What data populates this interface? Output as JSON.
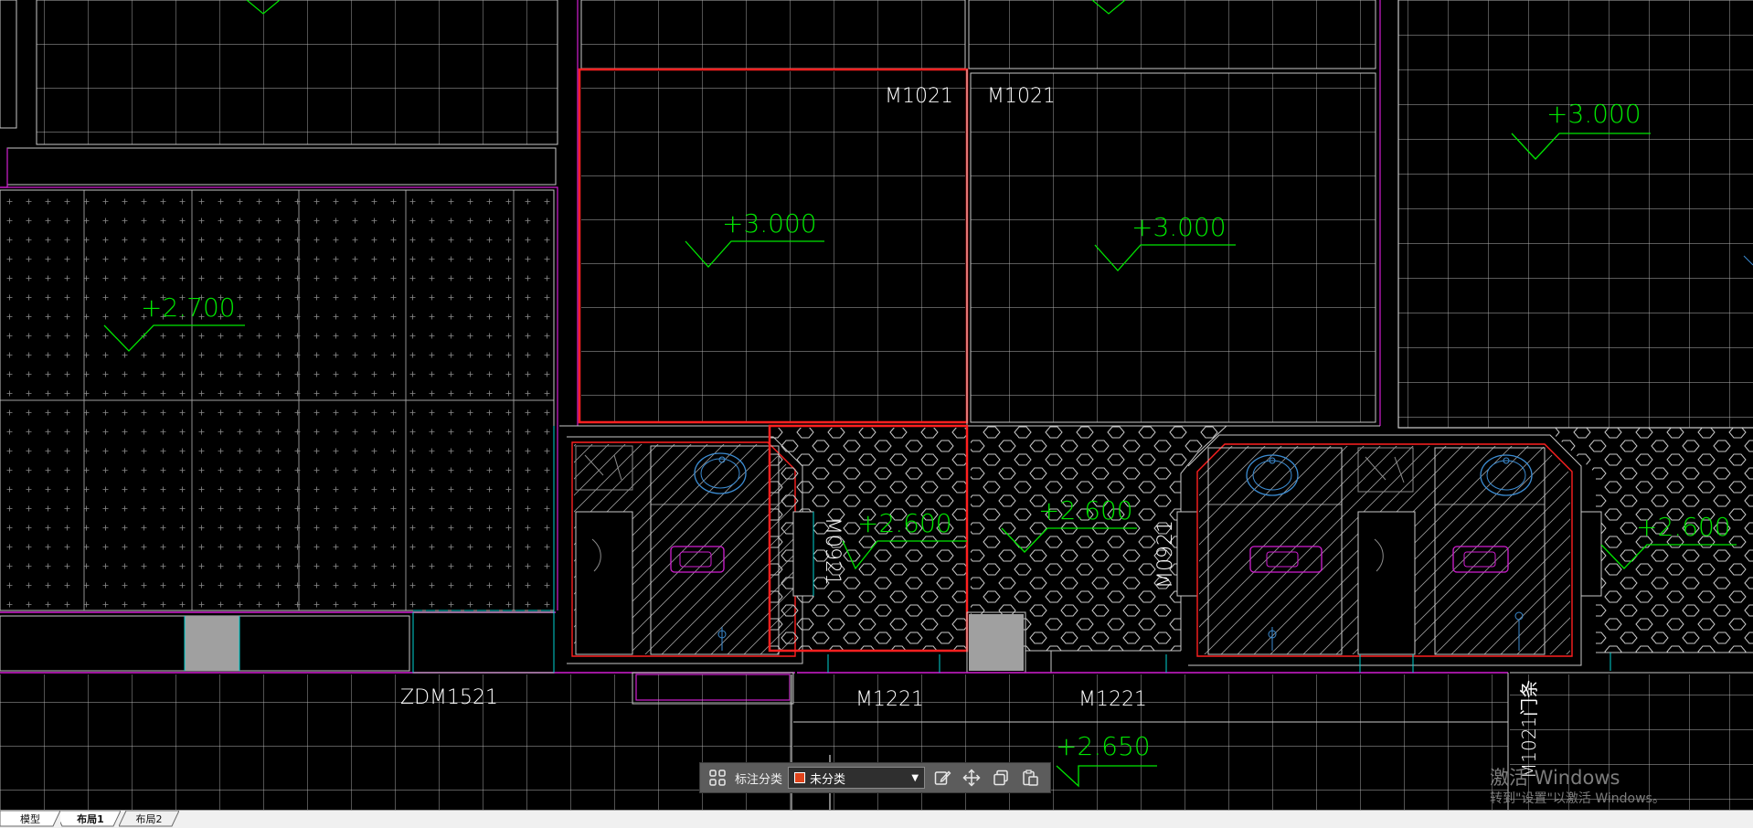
{
  "drawing": {
    "elevation_labels": [
      {
        "id": "elev-1",
        "text": "+3.000"
      },
      {
        "id": "elev-2",
        "text": "+3.000"
      },
      {
        "id": "elev-3",
        "text": "+3.000"
      },
      {
        "id": "elev-4",
        "text": "+2.700"
      },
      {
        "id": "elev-5",
        "text": "+2.600"
      },
      {
        "id": "elev-6",
        "text": "+2.600"
      },
      {
        "id": "elev-7",
        "text": "+2.600"
      },
      {
        "id": "elev-8",
        "text": "+2.650"
      }
    ],
    "door_labels": {
      "m1021_left": "M1021",
      "m1021_right": "M1021",
      "m0921_left": "M0921",
      "m0921_right": "M0921",
      "zdm1521": "ZDM1521",
      "m1221_left": "M1221",
      "m1221_right": "M1221",
      "m1021_strip": "M1021门条"
    },
    "colors": {
      "grid": "#b4b4b4",
      "wall_magenta": "#d21ed2",
      "elevation_green": "#00e600",
      "selection_red": "#ff2020",
      "cyan": "#00d2d2",
      "fixture_blue": "#3c8cd2"
    }
  },
  "toolbar": {
    "grid_icon": "grid-icon",
    "category_label": "标注分类",
    "category_value": "未分类",
    "swatch_color": "#e0441c",
    "icons": [
      "edit-icon",
      "move-icon",
      "copy-icon",
      "paste-icon"
    ]
  },
  "watermark": {
    "title": "激活 Windows",
    "subtitle": "转到\"设置\"以激活 Windows。"
  },
  "tabs": [
    {
      "label": "模型"
    },
    {
      "label": "布局1"
    },
    {
      "label": "布局2"
    }
  ]
}
